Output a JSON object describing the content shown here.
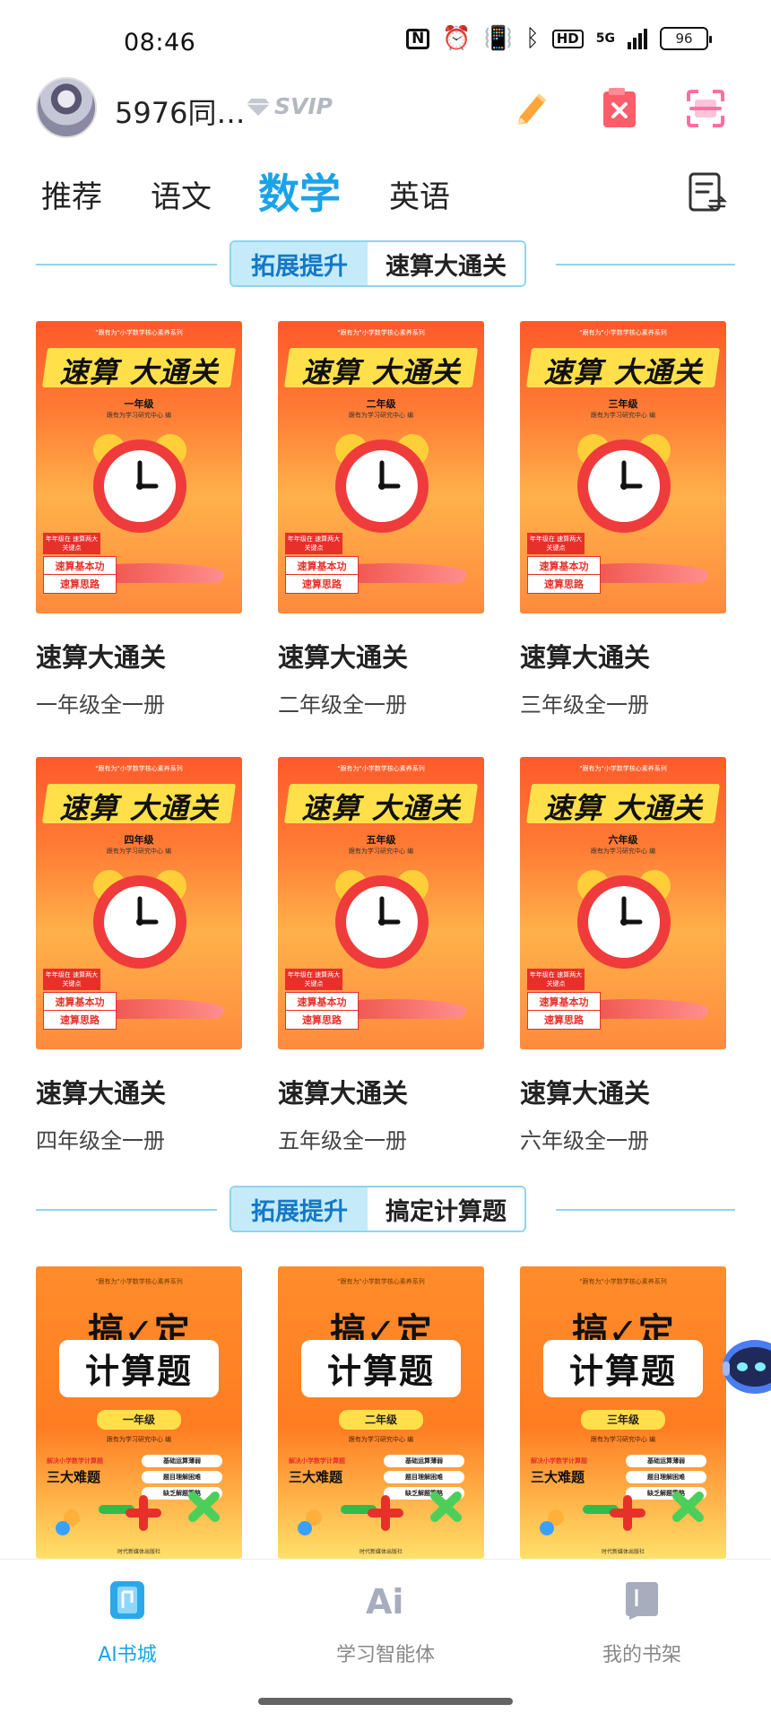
{
  "status_bar": {
    "time": "08:46",
    "nfc": "N",
    "hd": "HD",
    "network": "5G",
    "battery": "96"
  },
  "header": {
    "username": "5976同…",
    "vip_badge": "SVIP",
    "icons": [
      "edit-pencil-icon",
      "delete-bookmark-icon",
      "scan-icon"
    ]
  },
  "tabs": [
    {
      "label": "推荐"
    },
    {
      "label": "语文"
    },
    {
      "label": "数学"
    },
    {
      "label": "英语"
    }
  ],
  "active_tab": "数学",
  "sections": [
    {
      "tag": "拓展提升",
      "title": "速算大通关",
      "books": [
        {
          "title": "速算大通关",
          "subtitle": "一年级全一册",
          "cover_grade": "一年级"
        },
        {
          "title": "速算大通关",
          "subtitle": "二年级全一册",
          "cover_grade": "二年级"
        },
        {
          "title": "速算大通关",
          "subtitle": "三年级全一册",
          "cover_grade": "三年级"
        },
        {
          "title": "速算大通关",
          "subtitle": "四年级全一册",
          "cover_grade": "四年级"
        },
        {
          "title": "速算大通关",
          "subtitle": "五年级全一册",
          "cover_grade": "五年级"
        },
        {
          "title": "速算大通关",
          "subtitle": "六年级全一册",
          "cover_grade": "六年级"
        }
      ]
    },
    {
      "tag": "拓展提升",
      "title": "搞定计算题",
      "books": [
        {
          "cover_grade": "一年级"
        },
        {
          "cover_grade": "二年级"
        },
        {
          "cover_grade": "三年级"
        }
      ]
    }
  ],
  "cover_text": {
    "series_a": "\"跟有为\"小学数学核心素养系列",
    "title_a": "速算 大通关",
    "publisher_a": "跟有为学习研究中心 编",
    "tag1": "年年级在 速算两大关键点",
    "tag2": "速算基本功",
    "tag3": "速算思路",
    "series_b": "\"跟有为\"小学数学核心素养系列",
    "title_b1": "搞✓定",
    "title_b2": "计算题",
    "publisher_b": "跟有为学习研究中心 编",
    "left_b": "解决小学数学计算题",
    "big_b": "三大难题",
    "rtag1": "基础运算薄弱",
    "rtag2": "题目理解困难",
    "rtag3": "缺乏解题策略",
    "press_b": "时代新媒体出版社"
  },
  "bottom_nav": [
    {
      "label": "AI书城",
      "icon": "bookstore-icon",
      "active": true
    },
    {
      "label": "学习智能体",
      "icon": "ai-agent-icon",
      "active": false
    },
    {
      "label": "我的书架",
      "icon": "bookshelf-icon",
      "active": false
    }
  ],
  "colors": {
    "accent": "#1aa3e8",
    "pill_bg": "#c5ebfa",
    "pill_text": "#1578c6",
    "edit_icon": "#ffa53a",
    "delete_icon": "#ff5c6c",
    "scan_icon": "#ff6fa2"
  }
}
